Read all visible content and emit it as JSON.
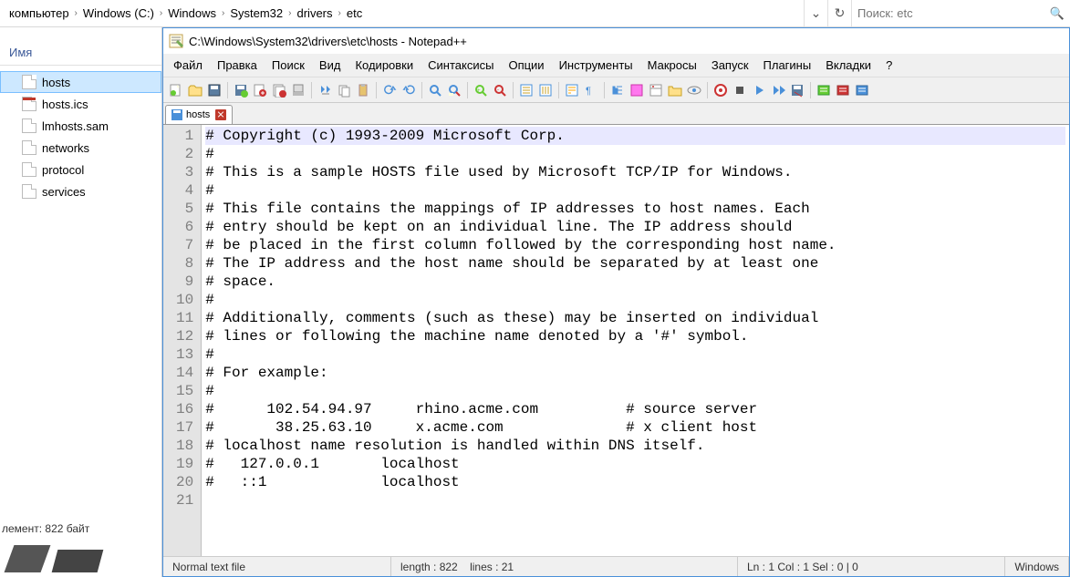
{
  "breadcrumb": {
    "segments": [
      "компьютер",
      "Windows (C:)",
      "Windows",
      "System32",
      "drivers",
      "etc"
    ],
    "search_placeholder": "Поиск: etc"
  },
  "explorer": {
    "column_header": "Имя",
    "items": [
      {
        "name": "hosts",
        "selected": true,
        "icon": "file"
      },
      {
        "name": "hosts.ics",
        "selected": false,
        "icon": "cal"
      },
      {
        "name": "lmhosts.sam",
        "selected": false,
        "icon": "file"
      },
      {
        "name": "networks",
        "selected": false,
        "icon": "file"
      },
      {
        "name": "protocol",
        "selected": false,
        "icon": "file"
      },
      {
        "name": "services",
        "selected": false,
        "icon": "file"
      }
    ],
    "status": "лемент: 822 байт"
  },
  "notepad": {
    "title": "C:\\Windows\\System32\\drivers\\etc\\hosts - Notepad++",
    "menu": [
      "Файл",
      "Правка",
      "Поиск",
      "Вид",
      "Кодировки",
      "Синтаксисы",
      "Опции",
      "Инструменты",
      "Макросы",
      "Запуск",
      "Плагины",
      "Вкладки",
      "?"
    ],
    "tab": {
      "name": "hosts"
    },
    "lines": [
      "# Copyright (c) 1993-2009 Microsoft Corp.",
      "#",
      "# This is a sample HOSTS file used by Microsoft TCP/IP for Windows.",
      "#",
      "# This file contains the mappings of IP addresses to host names. Each",
      "# entry should be kept on an individual line. The IP address should",
      "# be placed in the first column followed by the corresponding host name.",
      "# The IP address and the host name should be separated by at least one",
      "# space.",
      "#",
      "# Additionally, comments (such as these) may be inserted on individual",
      "# lines or following the machine name denoted by a '#' symbol.",
      "#",
      "# For example:",
      "#",
      "#      102.54.94.97     rhino.acme.com          # source server",
      "#       38.25.63.10     x.acme.com              # x client host",
      "# localhost name resolution is handled within DNS itself.",
      "#   127.0.0.1       localhost",
      "#   ::1             localhost",
      ""
    ],
    "status": {
      "filetype": "Normal text file",
      "length_label": "length : 822",
      "lines_label": "lines : 21",
      "position": "Ln : 1    Col : 1    Sel : 0 | 0",
      "encoding": "Windows"
    }
  }
}
